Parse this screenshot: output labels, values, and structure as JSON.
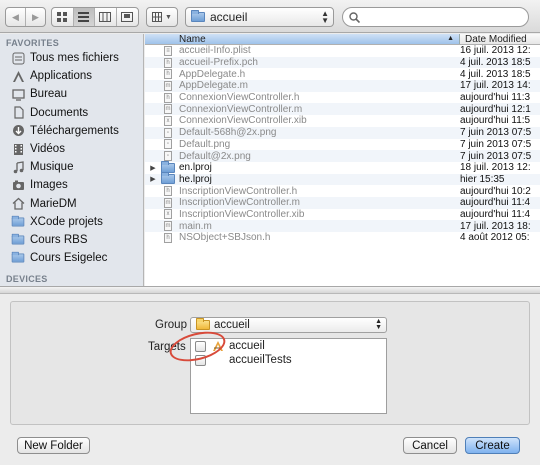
{
  "toolbar": {
    "back_icon": "chevron-left-icon",
    "forward_icon": "chevron-right-icon",
    "views": [
      "icon-view",
      "list-view",
      "column-view",
      "coverflow-view"
    ],
    "arrange_icon": "grid-icon",
    "location": "accueil"
  },
  "sidebar": {
    "favorites_heading": "FAVORITES",
    "items": [
      {
        "label": "Tous mes fichiers",
        "icon": "all-files-icon"
      },
      {
        "label": "Applications",
        "icon": "applications-icon"
      },
      {
        "label": "Bureau",
        "icon": "desktop-icon"
      },
      {
        "label": "Documents",
        "icon": "documents-icon"
      },
      {
        "label": "Téléchargements",
        "icon": "downloads-icon"
      },
      {
        "label": "Vidéos",
        "icon": "movies-icon"
      },
      {
        "label": "Musique",
        "icon": "music-icon"
      },
      {
        "label": "Images",
        "icon": "pictures-icon"
      },
      {
        "label": "MarieDM",
        "icon": "home-icon"
      },
      {
        "label": "XCode projets",
        "icon": "folder-icon"
      },
      {
        "label": "Cours RBS",
        "icon": "folder-icon"
      },
      {
        "label": "Cours Esigelec",
        "icon": "folder-icon"
      }
    ],
    "devices_heading": "DEVICES"
  },
  "file_list": {
    "col_name": "Name",
    "col_date": "Date Modified",
    "rows": [
      {
        "name": "accueil-Info.plist",
        "date": "16 juil. 2013 12:",
        "type": "file",
        "glyph": "≡"
      },
      {
        "name": "accueil-Prefix.pch",
        "date": "4 juil. 2013 18:5",
        "type": "file",
        "glyph": "h"
      },
      {
        "name": "AppDelegate.h",
        "date": "4 juil. 2013 18:5",
        "type": "file",
        "glyph": "h"
      },
      {
        "name": "AppDelegate.m",
        "date": "17 juil. 2013 14:",
        "type": "file",
        "glyph": "m"
      },
      {
        "name": "ConnexionViewController.h",
        "date": "aujourd'hui 11:3",
        "type": "file",
        "glyph": "h"
      },
      {
        "name": "ConnexionViewController.m",
        "date": "aujourd'hui 12:1",
        "type": "file",
        "glyph": "m"
      },
      {
        "name": "ConnexionViewController.xib",
        "date": "aujourd'hui 11:5",
        "type": "file",
        "glyph": "x"
      },
      {
        "name": "Default-568h@2x.png",
        "date": "7 juin 2013 07:5",
        "type": "file",
        "glyph": "▫"
      },
      {
        "name": "Default.png",
        "date": "7 juin 2013 07:5",
        "type": "file",
        "glyph": "▫"
      },
      {
        "name": "Default@2x.png",
        "date": "7 juin 2013 07:5",
        "type": "file",
        "glyph": "▫"
      },
      {
        "name": "en.lproj",
        "date": "18 juil. 2013 12:",
        "type": "folder",
        "glyph": ""
      },
      {
        "name": "he.lproj",
        "date": "hier 15:35",
        "type": "folder",
        "glyph": ""
      },
      {
        "name": "InscriptionViewController.h",
        "date": "aujourd'hui 10:2",
        "type": "file",
        "glyph": "h"
      },
      {
        "name": "InscriptionViewController.m",
        "date": "aujourd'hui 11:4",
        "type": "file",
        "glyph": "m"
      },
      {
        "name": "InscriptionViewController.xib",
        "date": "aujourd'hui 11:4",
        "type": "file",
        "glyph": "x"
      },
      {
        "name": "main.m",
        "date": "17 juil. 2013 18:",
        "type": "file",
        "glyph": "m"
      },
      {
        "name": "NSObject+SBJson.h",
        "date": "4 août 2012 05:",
        "type": "file",
        "glyph": "h"
      }
    ]
  },
  "options": {
    "group_label": "Group",
    "group_value": "accueil",
    "targets_label": "Targets",
    "targets": [
      {
        "name": "accueil",
        "checked": false,
        "icon": "app-target-icon"
      },
      {
        "name": "accueilTests",
        "checked": false,
        "icon": ""
      }
    ]
  },
  "buttons": {
    "new_folder": "New Folder",
    "cancel": "Cancel",
    "create": "Create"
  },
  "colors": {
    "header_selected": "#9fc2ea",
    "annotation_circle": "#d84a3a",
    "primary_button": "#7fb2ef"
  }
}
